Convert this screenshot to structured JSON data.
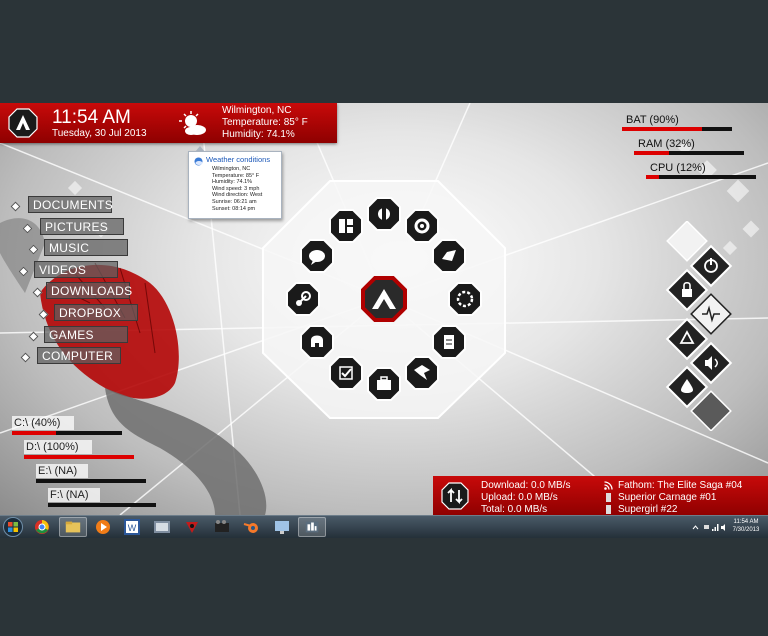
{
  "clock": {
    "time": "11:54 AM",
    "date": "Tuesday, 30 Jul 2013"
  },
  "weather": {
    "location": "Wilmington, NC",
    "temperature": "Temperature: 85° F",
    "humidity": "Humidity: 74.1%",
    "tooltip": {
      "title": "Weather conditions",
      "rows": [
        "Wilmington, NC",
        "Temperature: 85° F",
        "Humidity: 74.1%",
        "Wind speed: 3 mph",
        "Wind direction: West",
        "Sunrise: 06:21 am",
        "Sunset: 08:14 pm"
      ]
    }
  },
  "system_stats": [
    {
      "label": "BAT (90%)",
      "value": 0.9
    },
    {
      "label": "RAM (32%)",
      "value": 0.32
    },
    {
      "label": "CPU (12%)",
      "value": 0.12
    }
  ],
  "menu": [
    "DOCUMENTS",
    "PICTURES",
    "MUSIC",
    "VIDEOS",
    "DOWNLOADS",
    "DROPBOX",
    "GAMES",
    "COMPUTER"
  ],
  "drives": [
    {
      "label": "C:\\  (40%)",
      "value": 0.4
    },
    {
      "label": "D:\\  (100%)",
      "value": 1.0
    },
    {
      "label": "E:\\  (NA)",
      "value": 0
    },
    {
      "label": "F:\\  (NA)",
      "value": 0
    }
  ],
  "network": {
    "download": "Download: 0.0 MB/s",
    "upload": "Upload: 0.0 MB/s",
    "total": "Total: 0.0 MB/s"
  },
  "feeds": [
    "Fathom: The Elite Saga #04",
    "Superior Carnage #01",
    "Supergirl #22"
  ],
  "launcher": {
    "center_icon": "assassins-creed-logo-icon",
    "icons": [
      "skyrim-icon",
      "settings-cog-icon",
      "steam-logo-icon",
      "ring-icon",
      "document-icon",
      "eagle-icon",
      "briefcase-icon",
      "checkmark-icon",
      "helmet-icon",
      "steam-icon",
      "chat-icon",
      "grid-icon"
    ]
  },
  "side_buttons": [
    "diamond-icon",
    "power-icon",
    "lock-icon",
    "pulse-icon",
    "recycle-icon",
    "volume-icon",
    "water-drop-icon",
    "diamond-dark-icon"
  ],
  "taskbar": {
    "apps": [
      "chrome-icon",
      "explorer-icon",
      "media-player-icon",
      "word-icon",
      "app-icon",
      "game-icon",
      "video-icon",
      "blender-icon",
      "network-app-icon",
      "rainmeter-icon"
    ],
    "tray_time": "11:54 AM",
    "tray_date": "7/30/2013"
  },
  "colors": {
    "accent": "#c80a0a",
    "taskbar": "#2f3d48",
    "background": "#2b3438"
  }
}
